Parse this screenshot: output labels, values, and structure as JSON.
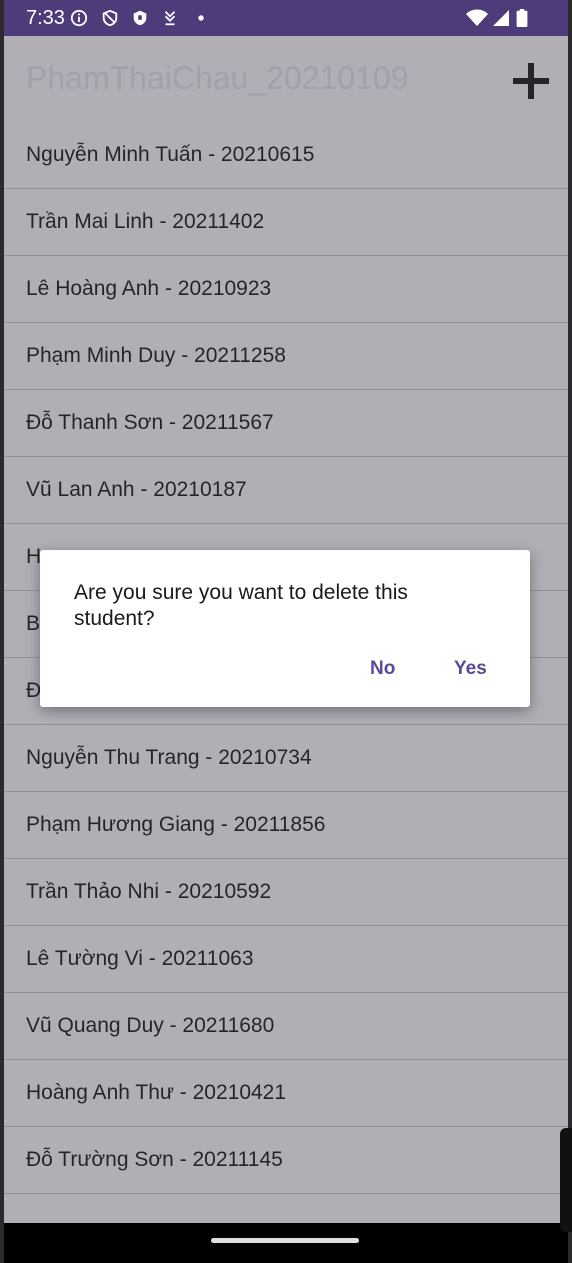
{
  "status_bar": {
    "time": "7:33",
    "left_icons": [
      "info-icon",
      "shield-outline-icon",
      "shield-filled-icon",
      "download-arrows-icon",
      "dot-icon"
    ],
    "right_icons": [
      "wifi-icon",
      "signal-icon",
      "battery-icon"
    ]
  },
  "app_bar": {
    "title": "PhamThaiChau_20210109",
    "add_icon": "plus-icon"
  },
  "students": [
    {
      "label": "Nguyễn Minh Tuấn - 20210615"
    },
    {
      "label": "Trần Mai Linh - 20211402"
    },
    {
      "label": "Lê Hoàng Anh - 20210923"
    },
    {
      "label": "Phạm Minh Duy - 20211258"
    },
    {
      "label": "Đỗ Thanh Sơn - 20211567"
    },
    {
      "label": "Vũ Lan Anh - 20210187"
    },
    {
      "label": "H"
    },
    {
      "label": "B"
    },
    {
      "label": "Đ"
    },
    {
      "label": "Nguyễn Thu Trang - 20210734"
    },
    {
      "label": "Phạm Hương Giang - 20211856"
    },
    {
      "label": "Trần Thảo Nhi - 20210592"
    },
    {
      "label": "Lê Tường Vi - 20211063"
    },
    {
      "label": "Vũ Quang Duy - 20211680"
    },
    {
      "label": "Hoàng Anh Thư - 20210421"
    },
    {
      "label": "Đỗ Trường Sơn - 20211145"
    }
  ],
  "dialog": {
    "message": "Are you sure you want to delete this student?",
    "no_label": "No",
    "yes_label": "Yes"
  },
  "colors": {
    "status_bar": "#4e3b7a",
    "accent": "#5b4a9a",
    "scrim": "#463e52"
  }
}
